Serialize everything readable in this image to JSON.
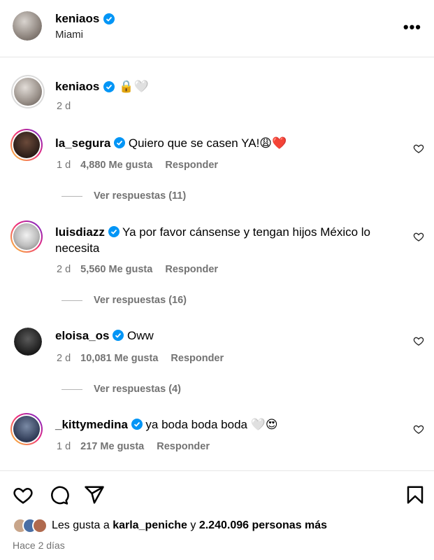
{
  "post_header": {
    "username": "keniaos",
    "location": "Miami",
    "more_icon": "more-horizontal-icon"
  },
  "caption": {
    "username": "keniaos",
    "emojis": "🔒🤍",
    "time": "2 d"
  },
  "comments": [
    {
      "username": "la_segura",
      "text": "Quiero que se casen YA!😩❤️",
      "time": "1 d",
      "likes": "4,880 Me gusta",
      "reply": "Responder",
      "view_replies": "Ver respuestas (11)"
    },
    {
      "username": "luisdiazz",
      "text": "Ya por favor cánsense y tengan hijos México lo",
      "text_cont": "necesita",
      "time": "2 d",
      "likes": "5,560 Me gusta",
      "reply": "Responder",
      "view_replies": "Ver respuestas (16)"
    },
    {
      "username": "eloisa_os",
      "text": "Oww",
      "time": "2 d",
      "likes": "10,081 Me gusta",
      "reply": "Responder",
      "view_replies": "Ver respuestas (4)"
    },
    {
      "username": "_kittymedina",
      "text": "ya boda boda boda 🤍😍",
      "time": "1 d",
      "likes": "217 Me gusta",
      "reply": "Responder"
    }
  ],
  "footer": {
    "likes_prefix": "Les gusta a",
    "likes_user": "karla_peniche",
    "likes_and": "y",
    "likes_count": "2.240.096 personas más",
    "time": "Hace 2 días"
  },
  "colors": {
    "verified": "#0095f6",
    "muted": "#737373",
    "divider": "#e6e6e6"
  }
}
